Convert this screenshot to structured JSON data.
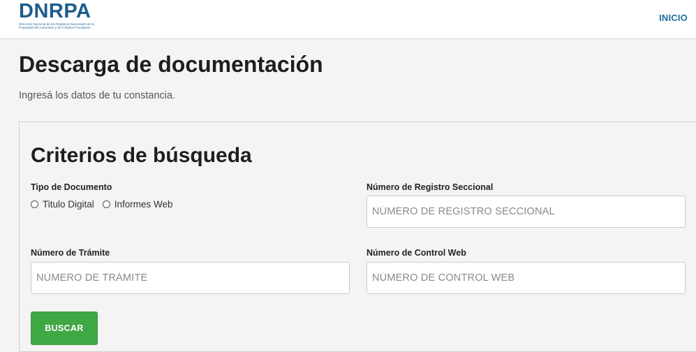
{
  "header": {
    "logo_text": "DNRPA",
    "logo_subtitle": "Dirección Nacional de los Registros Nacionales de la Propiedad del Automotor y de Créditos Prendarios",
    "nav_inicio": "INICIO",
    "brand_color": "#1c5d8c"
  },
  "page": {
    "title": "Descarga de documentación",
    "subtitle": "Ingresá los datos de tu constancia."
  },
  "search": {
    "title": "Criterios de búsqueda",
    "tipo_documento": {
      "label": "Tipo de Documento",
      "options": [
        "Titulo Digital",
        "Informes Web"
      ]
    },
    "registro_seccional": {
      "label": "Número de Registro Seccional",
      "placeholder": "NÚMERO DE REGISTRO SECCIONAL",
      "value": ""
    },
    "tramite": {
      "label": "Número de Trámite",
      "placeholder": "NÚMERO DE TRÁMITE",
      "value": ""
    },
    "control_web": {
      "label": "Número de Control Web",
      "placeholder": "NÚMERO DE CONTROL WEB",
      "value": ""
    },
    "buscar_label": "BUSCAR",
    "button_color": "#3fa744"
  }
}
